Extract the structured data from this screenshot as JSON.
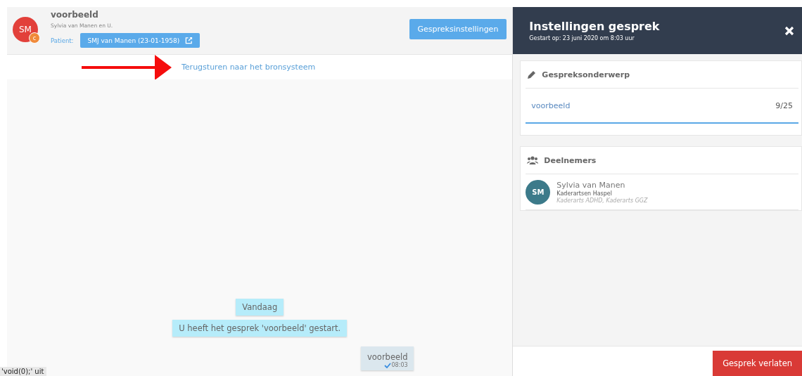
{
  "conversation": {
    "avatar": "SM",
    "avatar_badge": "c",
    "title": "voorbeeld",
    "participants": "Sylvia van Manen en U.",
    "patient_label": "Patient:",
    "patient_button": "SMJ van Manen (23-01-1958)",
    "settings_button": "Gespreksinstellingen",
    "return_link": "Terugsturen naar het bronsysteem"
  },
  "chat": {
    "date_label": "Vandaag",
    "system_message": "U heeft het gesprek 'voorbeeld' gestart.",
    "messages": [
      {
        "text": "voorbeeld",
        "time": "08:03",
        "read": true
      }
    ]
  },
  "status_bar": "'void(0);' uit",
  "panel": {
    "title": "Instellingen gesprek",
    "subtitle": "Gestart op: 23 juni 2020 om 8:03 uur",
    "subject": {
      "heading": "Gespreksonderwerp",
      "value": "voorbeeld",
      "count": "9/25"
    },
    "participants": {
      "heading": "Deelnemers",
      "items": [
        {
          "initials": "SM",
          "name": "Sylvia van Manen",
          "organization": "Kaderartsen Haspel",
          "roles": "Kaderarts ADHD, Kaderarts GGZ"
        }
      ]
    },
    "leave_button": "Gesprek verlaten"
  }
}
